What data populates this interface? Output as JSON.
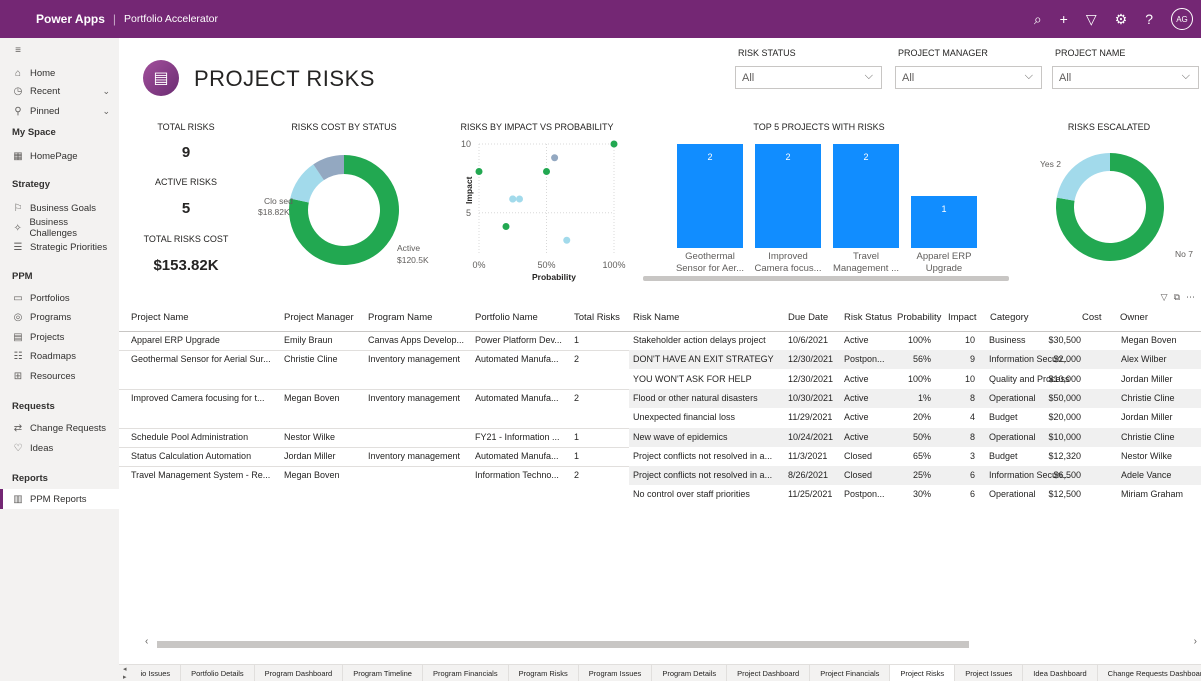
{
  "topbar": {
    "brand": "Power Apps",
    "app_name": "Portfolio Accelerator",
    "icons": [
      "search-icon",
      "add-icon",
      "filter-icon",
      "settings-icon",
      "help-icon"
    ],
    "avatar": "AG"
  },
  "sidebar": {
    "home": "Home",
    "recent": "Recent",
    "pinned": "Pinned",
    "myspace_header": "My Space",
    "homepage": "HomePage",
    "strategy_header": "Strategy",
    "business_goals": "Business Goals",
    "business_challenges": "Business Challenges",
    "strategic_priorities": "Strategic Priorities",
    "ppm_header": "PPM",
    "portfolios": "Portfolios",
    "programs": "Programs",
    "projects": "Projects",
    "roadmaps": "Roadmaps",
    "resources": "Resources",
    "requests_header": "Requests",
    "change_requests": "Change Requests",
    "ideas": "Ideas",
    "reports_header": "Reports",
    "ppm_reports": "PPM Reports"
  },
  "report": {
    "title": "PROJECT RISKS",
    "filters": {
      "risk_status_label": "RISK STATUS",
      "risk_status_value": "All",
      "project_manager_label": "PROJECT MANAGER",
      "project_manager_value": "All",
      "project_name_label": "PROJECT NAME",
      "project_name_value": "All"
    },
    "kpis": {
      "total_risks_label": "TOTAL RISKS",
      "total_risks_value": "9",
      "active_risks_label": "ACTIVE RISKS",
      "active_risks_value": "5",
      "total_cost_label": "TOTAL RISKS COST",
      "total_cost_value": "$153.82K"
    }
  },
  "chart_data": [
    {
      "type": "pie",
      "title": "RISKS COST BY STATUS",
      "labels": [
        "Active",
        "Closed",
        "Postponed"
      ],
      "values": [
        120.5,
        18.82,
        14.5
      ],
      "data_labels": {
        "active": "Active",
        "active_value": "$120.5K",
        "closed": "Clo sed",
        "closed_value": "$18.82K"
      },
      "colors": [
        "#22a851",
        "#a2daeb",
        "#93a8c1"
      ]
    },
    {
      "type": "scatter",
      "title": "RISKS BY IMPACT VS PROBABILITY",
      "xlabel": "Probability",
      "ylabel": "Impact",
      "x_ticks": [
        "0%",
        "50%",
        "100%"
      ],
      "y_ticks": [
        "5",
        "10"
      ],
      "xlim": [
        0,
        1
      ],
      "ylim": [
        2,
        10
      ],
      "points": [
        {
          "x": 0.0,
          "y": 8,
          "status": "Active"
        },
        {
          "x": 0.2,
          "y": 4,
          "status": "Active"
        },
        {
          "x": 0.5,
          "y": 8,
          "status": "Active"
        },
        {
          "x": 1.0,
          "y": 10,
          "status": "Active"
        },
        {
          "x": 0.56,
          "y": 9,
          "status": "Postponed"
        },
        {
          "x": 0.25,
          "y": 6,
          "status": "Closed"
        },
        {
          "x": 0.3,
          "y": 6,
          "status": "Closed"
        },
        {
          "x": 0.65,
          "y": 3,
          "status": "Closed"
        },
        {
          "x": 0.25,
          "y": 6,
          "status": "Closed"
        }
      ],
      "colors": {
        "Active": "#22a851",
        "Closed": "#a2daeb",
        "Postponed": "#93a8c1"
      }
    },
    {
      "type": "bar",
      "title": "TOP 5 PROJECTS WITH RISKS",
      "categories": [
        "Geothermal Sensor for Aer...",
        "Improved Camera focus...",
        "Travel Management ...",
        "Apparel ERP Upgrade"
      ],
      "category_lines": [
        [
          "Geothermal",
          "Sensor for Aer..."
        ],
        [
          "Improved",
          "Camera focus..."
        ],
        [
          "Travel",
          "Management ..."
        ],
        [
          "Apparel ERP",
          "Upgrade"
        ]
      ],
      "values": [
        2,
        2,
        2,
        1
      ],
      "ylim": [
        0,
        2
      ],
      "color": "#118dff"
    },
    {
      "type": "pie",
      "title": "RISKS ESCALATED",
      "labels": [
        "No",
        "Yes"
      ],
      "values": [
        7,
        2
      ],
      "data_labels": {
        "yes": "Yes 2",
        "no": "No 7"
      },
      "colors": [
        "#22a851",
        "#a2daeb"
      ]
    }
  ],
  "table": {
    "columns": [
      "Project Name",
      "Project Manager",
      "Program Name",
      "Portfolio Name",
      "Total Risks",
      "Risk Name",
      "Due Date",
      "Risk Status",
      "Probability",
      "Impact",
      "Category",
      "Cost",
      "Owner"
    ],
    "projects": [
      {
        "project": "Apparel ERP Upgrade",
        "manager": "Emily Braun",
        "program": "Canvas Apps Develop...",
        "portfolio": "Power Platform Dev...",
        "total": "1"
      },
      {
        "project": "Geothermal Sensor for Aerial Sur...",
        "manager": "Christie Cline",
        "program": "Inventory management",
        "portfolio": "Automated Manufa...",
        "total": "2"
      },
      {
        "project": "Improved Camera focusing for t...",
        "manager": "Megan Boven",
        "program": "Inventory management",
        "portfolio": "Automated Manufa...",
        "total": "2"
      },
      {
        "project": "Schedule Pool Administration",
        "manager": "Nestor Wilke",
        "program": "",
        "portfolio": "FY21 - Information ...",
        "total": "1"
      },
      {
        "project": "Status Calculation Automation",
        "manager": "Jordan Miller",
        "program": "Inventory management",
        "portfolio": "Automated Manufa...",
        "total": "1"
      },
      {
        "project": "Travel Management System - Re...",
        "manager": "Megan Boven",
        "program": "",
        "portfolio": "Information Techno...",
        "total": "2"
      }
    ],
    "risks": [
      {
        "name": "Stakeholder action delays project",
        "due": "10/6/2021",
        "status": "Active",
        "prob": "100%",
        "impact": "10",
        "category": "Business",
        "cost": "$30,500",
        "owner": "Megan Boven"
      },
      {
        "name": "DON'T HAVE AN EXIT STRATEGY",
        "due": "12/30/2021",
        "status": "Postpon...",
        "prob": "56%",
        "impact": "9",
        "category": "Information Securi...",
        "cost": "$2,000",
        "owner": "Alex Wilber"
      },
      {
        "name": "YOU WON'T ASK FOR HELP",
        "due": "12/30/2021",
        "status": "Active",
        "prob": "100%",
        "impact": "10",
        "category": "Quality and Process",
        "cost": "$10,000",
        "owner": "Jordan Miller"
      },
      {
        "name": "Flood or other natural disasters",
        "due": "10/30/2021",
        "status": "Active",
        "prob": "1%",
        "impact": "8",
        "category": "Operational",
        "cost": "$50,000",
        "owner": "Christie Cline"
      },
      {
        "name": "Unexpected financial loss",
        "due": "11/29/2021",
        "status": "Active",
        "prob": "20%",
        "impact": "4",
        "category": "Budget",
        "cost": "$20,000",
        "owner": "Jordan Miller"
      },
      {
        "name": "New wave of epidemics",
        "due": "10/24/2021",
        "status": "Active",
        "prob": "50%",
        "impact": "8",
        "category": "Operational",
        "cost": "$10,000",
        "owner": "Christie Cline"
      },
      {
        "name": "Project conflicts not resolved in a...",
        "due": "11/3/2021",
        "status": "Closed",
        "prob": "65%",
        "impact": "3",
        "category": "Budget",
        "cost": "$12,320",
        "owner": "Nestor Wilke"
      },
      {
        "name": "Project conflicts not resolved in a...",
        "due": "8/26/2021",
        "status": "Closed",
        "prob": "25%",
        "impact": "6",
        "category": "Information Securi...",
        "cost": "$6,500",
        "owner": "Adele Vance"
      },
      {
        "name": "No control over staff priorities",
        "due": "11/25/2021",
        "status": "Postpon...",
        "prob": "30%",
        "impact": "6",
        "category": "Operational",
        "cost": "$12,500",
        "owner": "Miriam Graham"
      }
    ]
  },
  "tabs": [
    "io Issues",
    "Portfolio Details",
    "Program Dashboard",
    "Program Timeline",
    "Program Financials",
    "Program Risks",
    "Program Issues",
    "Program Details",
    "Project Dashboard",
    "Project Financials",
    "Project Risks",
    "Project Issues",
    "Idea Dashboard",
    "Change Requests Dashboard"
  ],
  "active_tab": "Project Risks"
}
